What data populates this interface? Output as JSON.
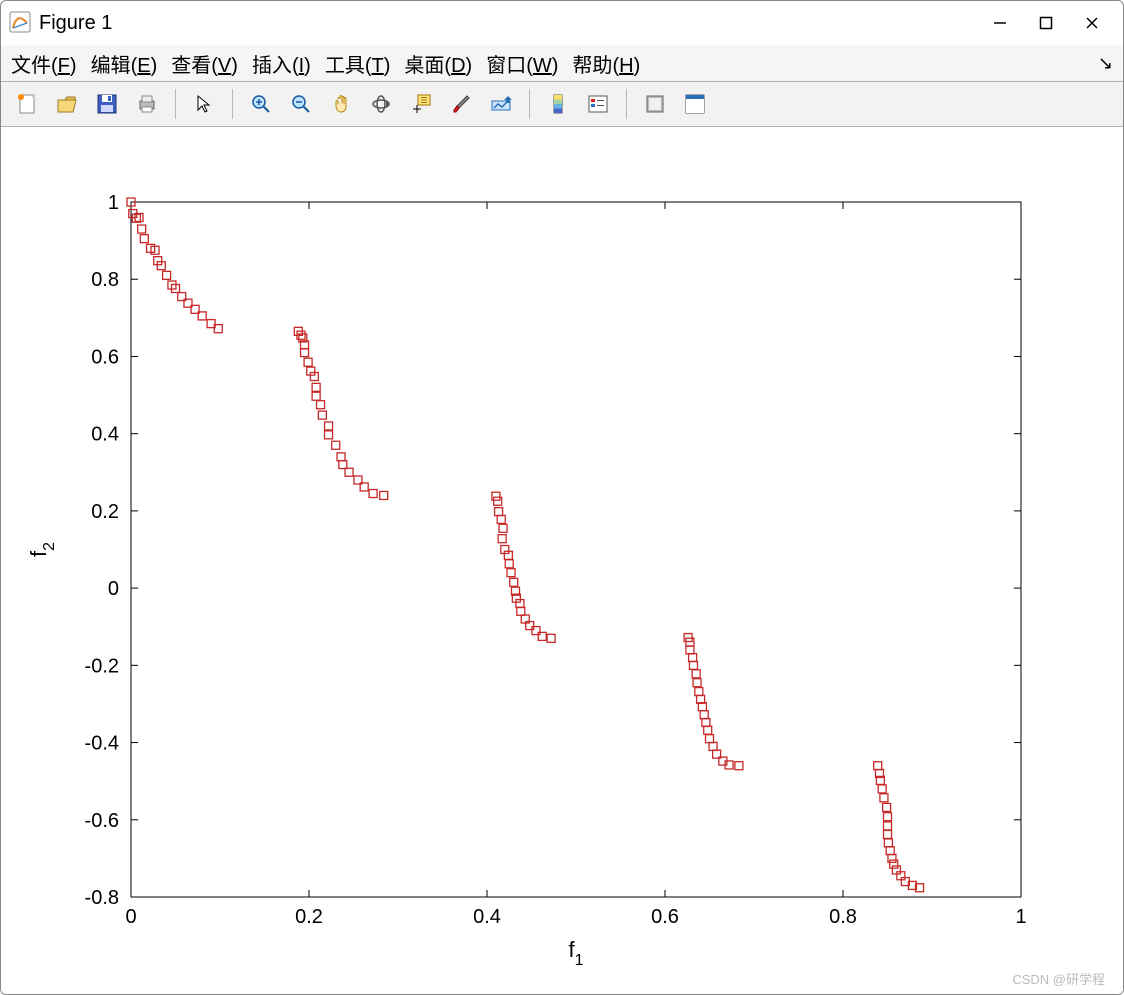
{
  "window": {
    "title": "Figure 1"
  },
  "menubar": [
    {
      "label": "文件",
      "accel": "F"
    },
    {
      "label": "编辑",
      "accel": "E"
    },
    {
      "label": "查看",
      "accel": "V"
    },
    {
      "label": "插入",
      "accel": "I"
    },
    {
      "label": "工具",
      "accel": "T"
    },
    {
      "label": "桌面",
      "accel": "D"
    },
    {
      "label": "窗口",
      "accel": "W"
    },
    {
      "label": "帮助",
      "accel": "H"
    }
  ],
  "watermark": "CSDN @研学程",
  "chart_data": {
    "type": "scatter",
    "marker": "open-square",
    "marker_color": "#c62828",
    "xlabel": "f",
    "xlabel_sub": "1",
    "ylabel": "f",
    "ylabel_sub": "2",
    "xlim": [
      0,
      1
    ],
    "ylim": [
      -0.8,
      1
    ],
    "xticks": [
      0,
      0.2,
      0.4,
      0.6,
      0.8,
      1
    ],
    "yticks": [
      -0.8,
      -0.6,
      -0.4,
      -0.2,
      0,
      0.2,
      0.4,
      0.6,
      0.8,
      1
    ],
    "points": [
      [
        0.0,
        1.0
      ],
      [
        0.002,
        0.97
      ],
      [
        0.006,
        0.958
      ],
      [
        0.009,
        0.96
      ],
      [
        0.012,
        0.93
      ],
      [
        0.015,
        0.905
      ],
      [
        0.022,
        0.88
      ],
      [
        0.027,
        0.875
      ],
      [
        0.03,
        0.848
      ],
      [
        0.034,
        0.835
      ],
      [
        0.04,
        0.81
      ],
      [
        0.046,
        0.785
      ],
      [
        0.05,
        0.776
      ],
      [
        0.057,
        0.755
      ],
      [
        0.064,
        0.738
      ],
      [
        0.072,
        0.722
      ],
      [
        0.08,
        0.705
      ],
      [
        0.09,
        0.685
      ],
      [
        0.098,
        0.672
      ],
      [
        0.188,
        0.665
      ],
      [
        0.191,
        0.655
      ],
      [
        0.193,
        0.648
      ],
      [
        0.195,
        0.63
      ],
      [
        0.195,
        0.61
      ],
      [
        0.199,
        0.585
      ],
      [
        0.202,
        0.562
      ],
      [
        0.206,
        0.548
      ],
      [
        0.208,
        0.52
      ],
      [
        0.208,
        0.497
      ],
      [
        0.213,
        0.475
      ],
      [
        0.215,
        0.448
      ],
      [
        0.222,
        0.42
      ],
      [
        0.222,
        0.397
      ],
      [
        0.23,
        0.37
      ],
      [
        0.236,
        0.34
      ],
      [
        0.238,
        0.32
      ],
      [
        0.245,
        0.3
      ],
      [
        0.255,
        0.28
      ],
      [
        0.262,
        0.262
      ],
      [
        0.272,
        0.245
      ],
      [
        0.284,
        0.24
      ],
      [
        0.41,
        0.238
      ],
      [
        0.412,
        0.225
      ],
      [
        0.413,
        0.198
      ],
      [
        0.416,
        0.178
      ],
      [
        0.418,
        0.155
      ],
      [
        0.417,
        0.128
      ],
      [
        0.42,
        0.1
      ],
      [
        0.424,
        0.085
      ],
      [
        0.425,
        0.063
      ],
      [
        0.427,
        0.04
      ],
      [
        0.43,
        0.015
      ],
      [
        0.432,
        -0.008
      ],
      [
        0.433,
        -0.026
      ],
      [
        0.437,
        -0.04
      ],
      [
        0.438,
        -0.06
      ],
      [
        0.443,
        -0.08
      ],
      [
        0.448,
        -0.097
      ],
      [
        0.455,
        -0.11
      ],
      [
        0.462,
        -0.125
      ],
      [
        0.472,
        -0.13
      ],
      [
        0.626,
        -0.128
      ],
      [
        0.628,
        -0.14
      ],
      [
        0.628,
        -0.16
      ],
      [
        0.631,
        -0.18
      ],
      [
        0.632,
        -0.2
      ],
      [
        0.635,
        -0.222
      ],
      [
        0.636,
        -0.245
      ],
      [
        0.638,
        -0.268
      ],
      [
        0.64,
        -0.288
      ],
      [
        0.642,
        -0.307
      ],
      [
        0.644,
        -0.328
      ],
      [
        0.646,
        -0.348
      ],
      [
        0.648,
        -0.368
      ],
      [
        0.65,
        -0.39
      ],
      [
        0.654,
        -0.41
      ],
      [
        0.658,
        -0.43
      ],
      [
        0.665,
        -0.448
      ],
      [
        0.672,
        -0.458
      ],
      [
        0.683,
        -0.46
      ],
      [
        0.839,
        -0.46
      ],
      [
        0.841,
        -0.48
      ],
      [
        0.842,
        -0.498
      ],
      [
        0.844,
        -0.52
      ],
      [
        0.846,
        -0.543
      ],
      [
        0.849,
        -0.568
      ],
      [
        0.85,
        -0.592
      ],
      [
        0.85,
        -0.616
      ],
      [
        0.85,
        -0.638
      ],
      [
        0.851,
        -0.66
      ],
      [
        0.853,
        -0.68
      ],
      [
        0.855,
        -0.7
      ],
      [
        0.857,
        -0.715
      ],
      [
        0.86,
        -0.73
      ],
      [
        0.865,
        -0.745
      ],
      [
        0.87,
        -0.76
      ],
      [
        0.878,
        -0.77
      ],
      [
        0.886,
        -0.776
      ]
    ]
  }
}
